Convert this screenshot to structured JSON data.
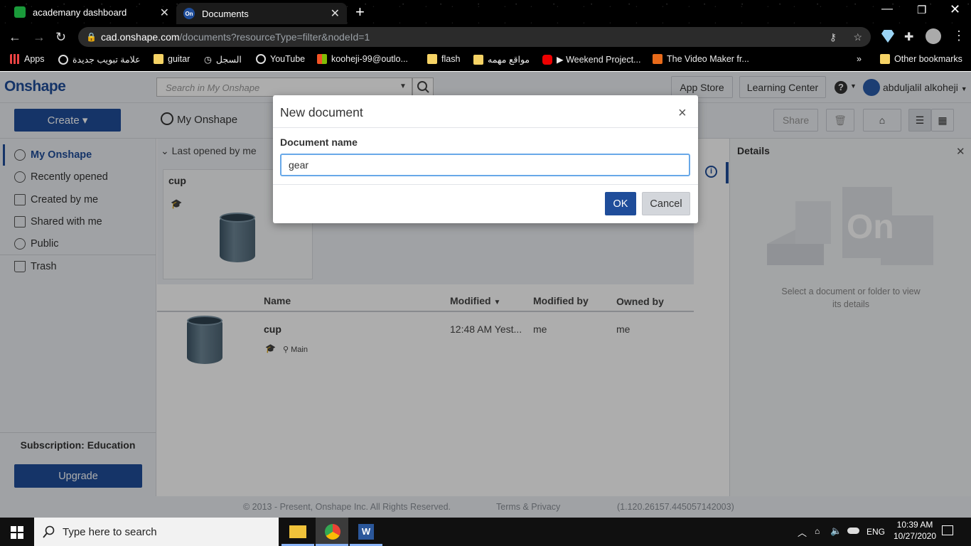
{
  "browser": {
    "tabs": [
      {
        "title": "academany dashboard",
        "icon": "academany-favicon",
        "color": "#1a9a3a"
      },
      {
        "title": "Documents",
        "icon": "onshape-favicon",
        "color": "#1f4d9a",
        "fav_text": "On"
      }
    ],
    "new_tab": "+",
    "url": {
      "host": "cad.onshape.com",
      "path": "/documents?resourceType=filter&nodeId=1"
    },
    "bookmarks": [
      {
        "label": "Apps",
        "icon": "apps-grid-icon"
      },
      {
        "label": "علامة تبويب جديدة",
        "icon": "globe-icon"
      },
      {
        "label": "guitar",
        "icon": "folder-icon"
      },
      {
        "label": "السجل",
        "icon": "history-icon"
      },
      {
        "label": "YouTube",
        "icon": "globe-icon"
      },
      {
        "label": "kooheji-99@outlo...",
        "icon": "microsoft-icon"
      },
      {
        "label": "flash",
        "icon": "folder-icon"
      },
      {
        "label": "مواقع مهمه",
        "icon": "folder-icon"
      },
      {
        "label": "▶ Weekend Project...",
        "icon": "youtube-icon"
      },
      {
        "label": "The Video Maker fr...",
        "icon": "v-icon"
      },
      {
        "label": "»",
        "icon": ""
      },
      {
        "label": "Other bookmarks",
        "icon": "folder-icon"
      }
    ]
  },
  "onshape": {
    "logo": "Onshape",
    "search_placeholder": "Search in My Onshape",
    "app_store": "App Store",
    "learning_center": "Learning Center",
    "help": "?",
    "user": "abduljalil alkoheji",
    "create": "Create ▾",
    "location": "My Onshape",
    "share": "Share",
    "sidebar": [
      {
        "label": "My Onshape",
        "active": true
      },
      {
        "label": "Recently opened"
      },
      {
        "label": "Created by me"
      },
      {
        "label": "Shared with me"
      },
      {
        "label": "Public"
      },
      {
        "label": "Trash"
      }
    ],
    "subscription": "Subscription: Education",
    "upgrade": "Upgrade",
    "recent_header": "Last opened by me",
    "card_title": "cup",
    "table": {
      "headers": [
        "Name",
        "Modified",
        "Modified by",
        "Owned by"
      ],
      "sort_indicator": "▼",
      "rows": [
        {
          "name": "cup",
          "branch": "Main",
          "modified": "12:48 AM Yest...",
          "modified_by": "me",
          "owned_by": "me"
        }
      ]
    },
    "details": {
      "title": "Details",
      "empty_text": "Select a document or folder to view its details"
    },
    "footer": {
      "copyright": "© 2013 - Present, Onshape Inc. All Rights Reserved.",
      "terms": "Terms & Privacy",
      "version": "(1.120.26157.445057142003)"
    }
  },
  "modal": {
    "title": "New document",
    "close": "×",
    "field_label": "Document name",
    "field_value": "gear",
    "ok": "OK",
    "cancel": "Cancel"
  },
  "taskbar": {
    "search_placeholder": "Type here to search",
    "language": "ENG",
    "time": "10:39 AM",
    "date": "10/27/2020"
  }
}
